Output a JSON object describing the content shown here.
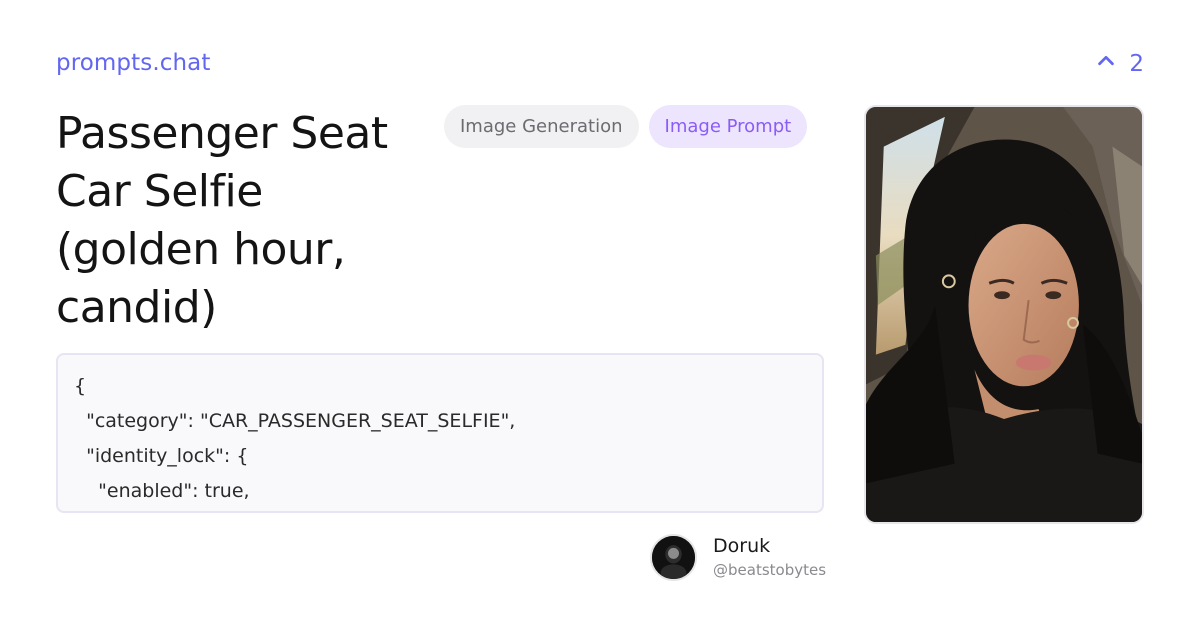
{
  "brand": {
    "name": "prompts.chat"
  },
  "upvote": {
    "count": "2"
  },
  "prompt": {
    "title": "Passenger Seat Car Selfie (golden hour, candid)",
    "tags": [
      {
        "label": "Image Generation",
        "style": "neutral"
      },
      {
        "label": "Image Prompt",
        "style": "accent"
      }
    ],
    "code_lines": [
      "{",
      "  \"category\": \"CAR_PASSENGER_SEAT_SELFIE\",",
      "  \"identity_lock\": {",
      "    \"enabled\": true,"
    ]
  },
  "author": {
    "name": "Doruk",
    "handle": "@beatstobytes"
  },
  "icons": {
    "upvote": "chevron-up-icon"
  },
  "colors": {
    "accent": "#6366f1",
    "tag_accent_bg": "#ede4fd",
    "tag_accent_text": "#8b5cf6"
  }
}
